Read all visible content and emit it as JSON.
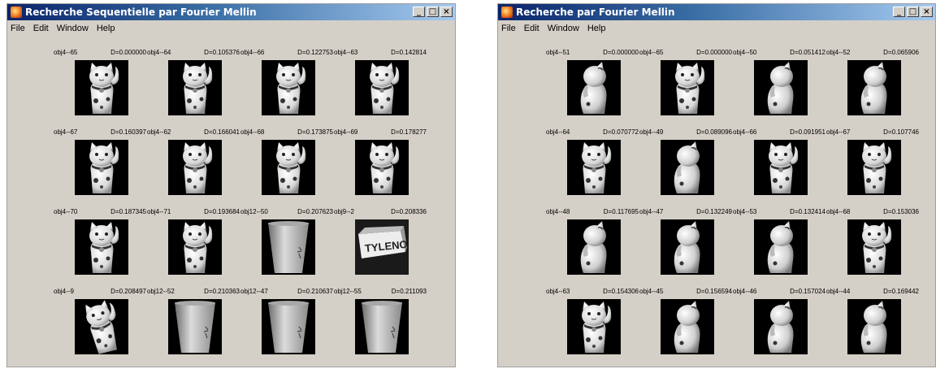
{
  "windows": [
    {
      "title": "Recherche Sequentielle par Fourier Mellin",
      "menu": [
        "File",
        "Edit",
        "Window",
        "Help"
      ],
      "results": [
        {
          "obj": "obj4--65",
          "dist": "D=0.000000",
          "icon": "cat-front"
        },
        {
          "obj": "obj4--64",
          "dist": "D=0.105376",
          "icon": "cat-front"
        },
        {
          "obj": "obj4--66",
          "dist": "D=0.122753",
          "icon": "cat-front"
        },
        {
          "obj": "obj4--63",
          "dist": "D=0.142814",
          "icon": "cat-front"
        },
        {
          "obj": "obj4--67",
          "dist": "D=0.160397",
          "icon": "cat-front"
        },
        {
          "obj": "obj4--62",
          "dist": "D=0.166041",
          "icon": "cat-front"
        },
        {
          "obj": "obj4--68",
          "dist": "D=0.173875",
          "icon": "cat-front"
        },
        {
          "obj": "obj4--69",
          "dist": "D=0.178277",
          "icon": "cat-front"
        },
        {
          "obj": "obj4--70",
          "dist": "D=0.187345",
          "icon": "cat-front"
        },
        {
          "obj": "obj4--71",
          "dist": "D=0.193684",
          "icon": "cat-front"
        },
        {
          "obj": "obj12--50",
          "dist": "D=0.207623",
          "icon": "cup"
        },
        {
          "obj": "obj9--2",
          "dist": "D=0.208336",
          "icon": "tylenol-box"
        },
        {
          "obj": "obj4--9",
          "dist": "D=0.208497",
          "icon": "cat-tilted"
        },
        {
          "obj": "obj12--52",
          "dist": "D=0.210363",
          "icon": "cup"
        },
        {
          "obj": "obj12--47",
          "dist": "D=0.210637",
          "icon": "cup"
        },
        {
          "obj": "obj12--55",
          "dist": "D=0.211093",
          "icon": "cup"
        }
      ]
    },
    {
      "title": "Recherche par Fourier Mellin",
      "menu": [
        "File",
        "Edit",
        "Window",
        "Help"
      ],
      "results": [
        {
          "obj": "obj4--51",
          "dist": "D=0.000000",
          "icon": "cat-side"
        },
        {
          "obj": "obj4--65",
          "dist": "D=0.000000",
          "icon": "cat-front"
        },
        {
          "obj": "obj4--50",
          "dist": "D=0.051412",
          "icon": "cat-side"
        },
        {
          "obj": "obj4--52",
          "dist": "D=0.065906",
          "icon": "cat-side"
        },
        {
          "obj": "obj4--64",
          "dist": "D=0.070772",
          "icon": "cat-front"
        },
        {
          "obj": "obj4--49",
          "dist": "D=0.089096",
          "icon": "cat-side"
        },
        {
          "obj": "obj4--66",
          "dist": "D=0.091951",
          "icon": "cat-front"
        },
        {
          "obj": "obj4--67",
          "dist": "D=0.107746",
          "icon": "cat-front"
        },
        {
          "obj": "obj4--48",
          "dist": "D=0.117695",
          "icon": "cat-side"
        },
        {
          "obj": "obj4--47",
          "dist": "D=0.132249",
          "icon": "cat-side"
        },
        {
          "obj": "obj4--53",
          "dist": "D=0.132414",
          "icon": "cat-side"
        },
        {
          "obj": "obj4--68",
          "dist": "D=0.153036",
          "icon": "cat-front"
        },
        {
          "obj": "obj4--63",
          "dist": "D=0.154306",
          "icon": "cat-front"
        },
        {
          "obj": "obj4--45",
          "dist": "D=0.156594",
          "icon": "cat-side"
        },
        {
          "obj": "obj4--46",
          "dist": "D=0.157024",
          "icon": "cat-side"
        },
        {
          "obj": "obj4--44",
          "dist": "D=0.169442",
          "icon": "cat-side"
        }
      ]
    }
  ],
  "window_buttons": {
    "minimize": "_",
    "maximize": "□",
    "close": "×"
  },
  "tylenol_text": "TYLENOL",
  "colors": {
    "thumb_bg": "#000000",
    "window_bg": "#d4d0c8",
    "title_start": "#0a246a",
    "title_end": "#a6caf0"
  }
}
